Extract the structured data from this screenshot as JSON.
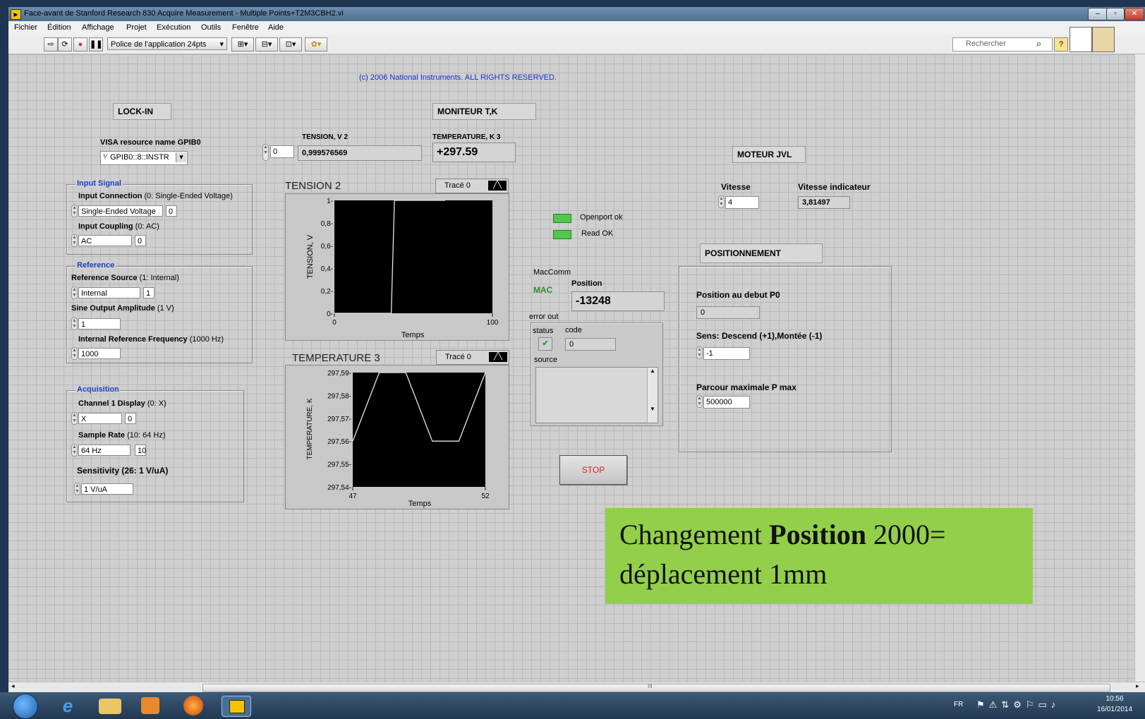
{
  "window": {
    "title": "Face-avant de Stanford Research 830 Acquire Measurement - Multiple Points+T2M3CBH2.vi",
    "controls": [
      "–",
      "▫",
      "✕"
    ]
  },
  "menu": [
    "Fichier",
    "Édition",
    "Affichage",
    "Projet",
    "Exécution",
    "Outils",
    "Fenêtre",
    "Aide"
  ],
  "toolbar": {
    "font_label": "Police de l'application 24pts",
    "search_placeholder": "Rechercher"
  },
  "copyright": "(c) 2006 National Instruments.  ALL RIGHTS RESERVED.",
  "lockin": {
    "label": "LOCK-IN",
    "visa_label": "VISA resource name GPIB0",
    "visa_value": "GPIB0::8::INSTR",
    "input_signal": {
      "title": "Input Signal",
      "connection_label": "Input Connection",
      "connection_hint": "(0: Single-Ended Voltage)",
      "connection_value": "Single-Ended Voltage",
      "connection_num": "0",
      "coupling_label": "Input Coupling",
      "coupling_hint": "(0: AC)",
      "coupling_value": "AC",
      "coupling_num": "0"
    },
    "reference": {
      "title": "Reference",
      "source_label": "Reference Source",
      "source_hint": "(1: Internal)",
      "source_value": "Internal",
      "source_num": "1",
      "amp_label": "Sine Output Amplitude",
      "amp_hint": "(1 V)",
      "amp_value": "1",
      "freq_label": "Internal Reference Frequency",
      "freq_hint": "(1000 Hz)",
      "freq_value": "1000"
    },
    "acquisition": {
      "title": "Acquisition",
      "channel_label": "Channel 1 Display",
      "channel_hint": "(0: X)",
      "channel_value": "X",
      "channel_num": "0",
      "rate_label": "Sample Rate",
      "rate_hint": "(10: 64 Hz)",
      "rate_value": "64 Hz",
      "rate_num": "10",
      "sens_label": "Sensitivity (26: 1 V/uA)",
      "sens_value": "1 V/uA"
    }
  },
  "tension": {
    "index_value": "0",
    "label": "TENSION, V 2",
    "value": "0,999576569"
  },
  "moniteur": {
    "label": "MONITEUR  T,K",
    "temp_label": "TEMPERATURE, K 3",
    "temp_value": "+297.59"
  },
  "graph1": {
    "title": "TENSION 2",
    "legend": "Tracé 0",
    "ylabel": "TENSION, V",
    "xlabel": "Temps"
  },
  "graph2": {
    "title": "TEMPERATURE 3",
    "legend": "Tracé 0",
    "ylabel": "TEMPERATURE, K",
    "xlabel": "Temps"
  },
  "chart_data": [
    {
      "type": "line",
      "title": "TENSION 2",
      "xlabel": "Temps",
      "ylabel": "TENSION, V",
      "xlim": [
        0,
        100
      ],
      "ylim": [
        0,
        1
      ],
      "x_ticks": [
        "0",
        "100"
      ],
      "y_ticks": [
        "0-",
        "0,2-",
        "0,4-",
        "0,6-",
        "0,8-",
        "1-"
      ],
      "series": [
        {
          "name": "Tracé 0",
          "x": [
            0,
            36,
            38,
            70
          ],
          "y": [
            0,
            0,
            1,
            1
          ]
        }
      ]
    },
    {
      "type": "line",
      "title": "TEMPERATURE 3",
      "xlabel": "Temps",
      "ylabel": "TEMPERATURE, K",
      "xlim": [
        47,
        52
      ],
      "ylim": [
        297.54,
        297.59
      ],
      "x_ticks": [
        "47",
        "52"
      ],
      "y_ticks": [
        "297,54-",
        "297,55-",
        "297,56-",
        "297,57-",
        "297,58-",
        "297,59-"
      ],
      "series": [
        {
          "name": "Tracé 0",
          "x": [
            47,
            48,
            49,
            50,
            51,
            52
          ],
          "y": [
            297.56,
            297.59,
            297.59,
            297.56,
            297.56,
            297.59
          ]
        }
      ]
    }
  ],
  "status": {
    "openport": "Openport ok",
    "read": "Read OK",
    "color": "#4ec94a"
  },
  "maccomm": {
    "label": "MacComm",
    "mac": "MAC",
    "position_label": "Position",
    "position_value": "-13248"
  },
  "error_out": {
    "label": "error out",
    "status_label": "status",
    "code_label": "code",
    "code_value": "0",
    "source_label": "source",
    "status_icon": "check-icon"
  },
  "stop_label": "STOP",
  "moteur": {
    "label": "MOTEUR JVL",
    "vitesse_label": "Vitesse",
    "vitesse_value": "4",
    "vitesse_ind_label": "Vitesse indicateur",
    "vitesse_ind_value": "3,81497"
  },
  "positionnement": {
    "label": "POSITIONNEMENT",
    "p0_label": "Position au debut P0",
    "p0_value": "0",
    "sens_label": "Sens: Descend (+1),Montée (-1)",
    "sens_value": "-1",
    "pmax_label": "Parcour maximale P max",
    "pmax_value": "500000"
  },
  "annotation": {
    "prefix": "Changement ",
    "bold": "Position",
    "suffix": " 2000=",
    "line2": "déplacement 1mm",
    "bg": "#93cf4b"
  },
  "hscroll_mark": "III",
  "taskbar": {
    "lang": "FR",
    "time": "10:56",
    "date": "16/01/2014"
  }
}
